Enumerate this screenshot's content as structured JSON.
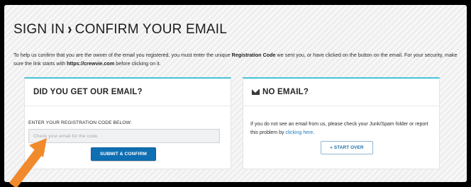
{
  "page": {
    "title_part1": "SIGN IN",
    "title_separator": "›",
    "title_part2": "CONFIRM YOUR EMAIL",
    "intro": {
      "before_code": "To help us confirm that you are the owner of the email you registered, you must enter the unique ",
      "code_term": "Registration Code",
      "between": " we sent you, or have clicked on the button on the email. For your security, make sure the link starts with ",
      "url": "https://crewvie.com",
      "after_url": " before clicking on it."
    }
  },
  "confirm_card": {
    "heading": "DID YOU GET OUR EMAIL?",
    "code_label": "ENTER YOUR REGISTRATION CODE BELOW:",
    "code_placeholder": "Check your email for the code.",
    "code_value": "",
    "submit_label": "SUBMIT & CONFIRM"
  },
  "no_email_card": {
    "icon": "envelope-icon",
    "heading": "NO EMAIL?",
    "text_before_link": "If you do not see an email from us, please check your Junk/Spam folder or report this problem by ",
    "link_text": "clicking here",
    "text_after_link": ".",
    "start_over_label": "« START OVER"
  },
  "annotation": {
    "icon": "arrow-pointer-icon",
    "color": "#f08a2c"
  },
  "colors": {
    "accent": "#45c3d6",
    "primary_button": "#0f6fb3",
    "link": "#1d7cc0"
  }
}
